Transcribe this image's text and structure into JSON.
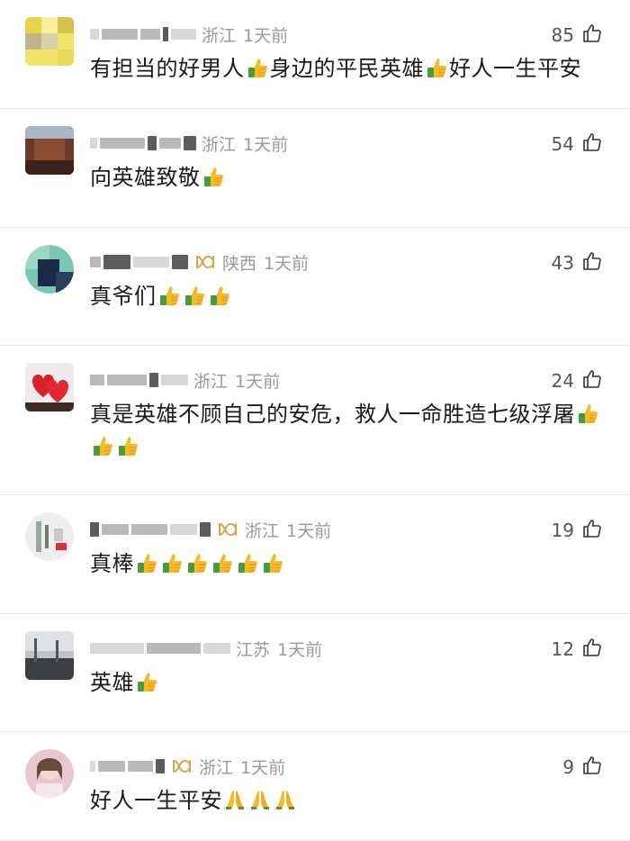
{
  "comments": [
    {
      "location": "浙江",
      "time": "1天前",
      "likes": "85",
      "text": "有担当的好男人",
      "segments": [
        {
          "t": "有担当的好男人"
        },
        {
          "e": "thumbs-up"
        },
        {
          "t": "身边的平民英雄"
        },
        {
          "e": "thumbs-up"
        },
        {
          "t": "好人一生平安"
        }
      ],
      "badge": false
    },
    {
      "location": "浙江",
      "time": "1天前",
      "likes": "54",
      "segments": [
        {
          "t": "向英雄致敬"
        },
        {
          "e": "thumbs-up"
        }
      ],
      "badge": false
    },
    {
      "location": "陕西",
      "time": "1天前",
      "likes": "43",
      "segments": [
        {
          "t": "真爷们"
        },
        {
          "e": "thumbs-up"
        },
        {
          "e": "thumbs-up"
        },
        {
          "e": "thumbs-up"
        }
      ],
      "badge": true
    },
    {
      "location": "浙江",
      "time": "1天前",
      "likes": "24",
      "segments": [
        {
          "t": "真是英雄不顾自己的安危，救人一命胜造七级浮屠"
        },
        {
          "e": "thumbs-up"
        },
        {
          "e": "thumbs-up"
        },
        {
          "e": "thumbs-up"
        }
      ],
      "badge": false
    },
    {
      "location": "浙江",
      "time": "1天前",
      "likes": "19",
      "segments": [
        {
          "t": "真棒"
        },
        {
          "e": "thumbs-up"
        },
        {
          "e": "thumbs-up"
        },
        {
          "e": "thumbs-up"
        },
        {
          "e": "thumbs-up"
        },
        {
          "e": "thumbs-up"
        },
        {
          "e": "thumbs-up"
        }
      ],
      "badge": true
    },
    {
      "location": "江苏",
      "time": "1天前",
      "likes": "12",
      "segments": [
        {
          "t": "英雄"
        },
        {
          "e": "thumbs-up"
        }
      ],
      "badge": false
    },
    {
      "location": "浙江",
      "time": "1天前",
      "likes": "9",
      "segments": [
        {
          "t": "好人一生平安"
        },
        {
          "e": "praying-hands"
        },
        {
          "e": "praying-hands"
        },
        {
          "e": "praying-hands"
        }
      ],
      "badge": true
    }
  ],
  "icons": {
    "like": "thumbs-up-outline-icon",
    "badge": "infinity-badge-icon"
  },
  "colors": {
    "meta_gray": "#9a9a9a",
    "badge_gold": "#d4a74a",
    "emoji_yellow": "#f5b92a",
    "emoji_cuff": "#4b9b3c"
  }
}
